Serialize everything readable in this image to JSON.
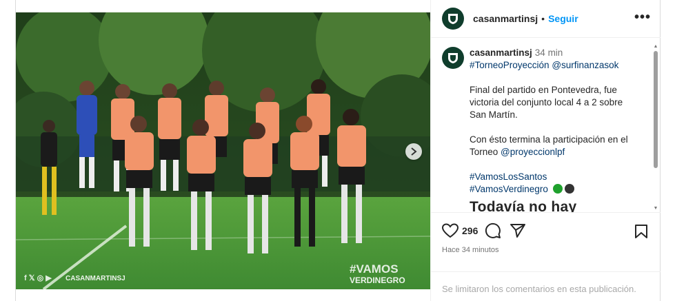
{
  "post": {
    "username": "casanmartinsj",
    "follow_label": "Seguir",
    "more_label": "•••",
    "photo": {
      "watermark_left": "CASANMARTINSJ",
      "watermark_right_top": "#VAMOS",
      "watermark_right_bottom": "VERDINEGRO",
      "next_icon": "chevron-right-icon"
    },
    "caption": {
      "username": "casanmartinsj",
      "time": "34 min",
      "tags_line": [
        "#TorneoProyección",
        "@surfinanzasok"
      ],
      "paragraph1": "Final del partido en Pontevedra, fue victoria del conjunto local 4 a 2 sobre San Martín.",
      "paragraph2_text": "Con ésto termina la participación en el Torneo ",
      "paragraph2_link": "@proyeccionlpf",
      "hashtag1": "#VamosLosSantos",
      "hashtag2": "#VamosVerdinegro",
      "emoji_colors": [
        "#1fa12d",
        "#333333"
      ],
      "cutoff_text": "Todavía no hay"
    },
    "actions": {
      "likes": "296",
      "icons": [
        "heart-icon",
        "comment-icon",
        "share-icon",
        "bookmark-icon"
      ],
      "time_ago": "Hace 34 minutos"
    },
    "comments_off": "Se limitaron los comentarios en esta publicación."
  },
  "colors": {
    "accent": "#0095f6",
    "jersey": "#f2956b",
    "keeper": "#2d4fb8",
    "pitch": "#4f9a3c"
  }
}
